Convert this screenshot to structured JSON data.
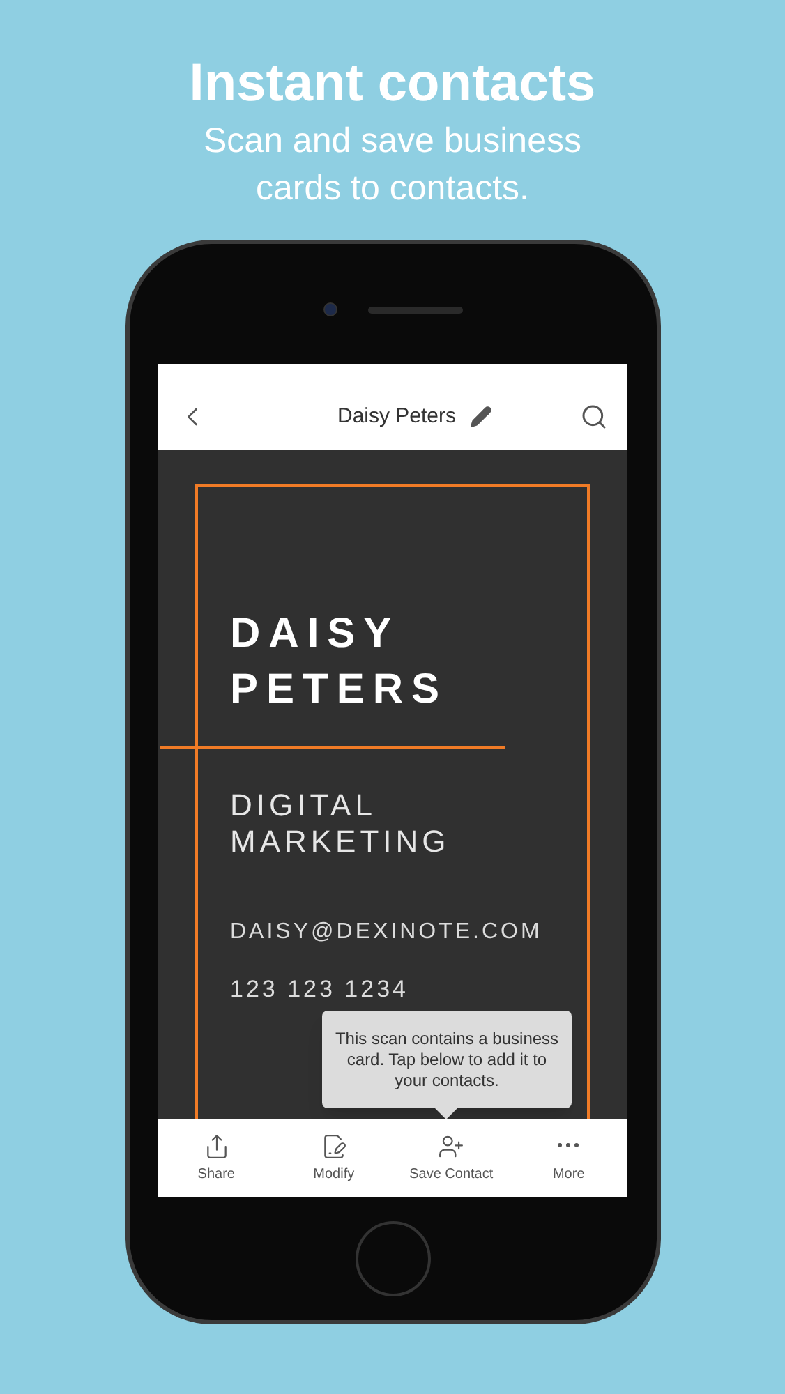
{
  "headline": "Instant contacts",
  "subhead": "Scan and save business cards to contacts.",
  "header": {
    "title": "Daisy Peters"
  },
  "card": {
    "name_lines": [
      "DAISY",
      "PETERS"
    ],
    "role_lines": [
      "DIGITAL",
      "MARKETING"
    ],
    "email": "DAISY@DEXINOTE.COM",
    "phone": "123 123 1234"
  },
  "tooltip": "This scan contains a business card. Tap below to add it to your contacts.",
  "toolbar": [
    {
      "kind": "share",
      "label": "Share"
    },
    {
      "kind": "modify",
      "label": "Modify"
    },
    {
      "kind": "contact",
      "label": "Save Contact"
    },
    {
      "kind": "more",
      "label": "More"
    }
  ]
}
